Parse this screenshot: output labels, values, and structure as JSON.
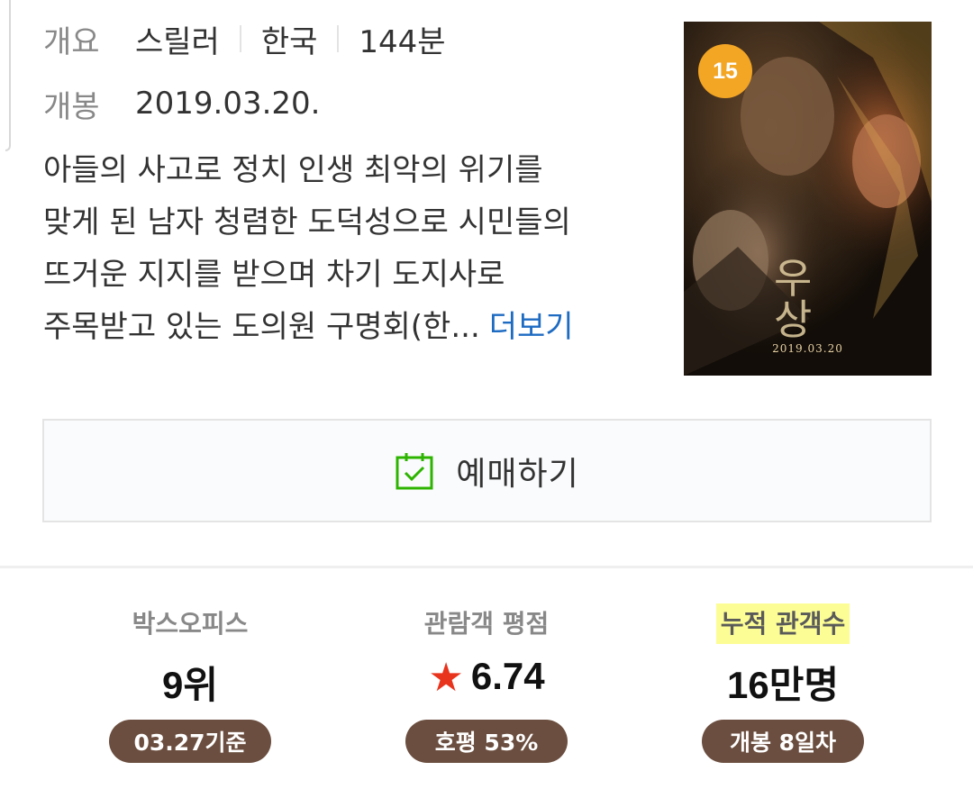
{
  "info": {
    "overview_label": "개요",
    "genre": "스릴러",
    "country": "한국",
    "runtime": "144분",
    "release_label": "개봉",
    "release_date": "2019.03.20."
  },
  "synopsis": {
    "lines": [
      "아들의 사고로 정치 인생 최악의 위기를",
      "맞게 된 남자 청렴한 도덕성으로 시민들의",
      "뜨거운 지지를 받으며 차기 도지사로",
      "주목받고 있는 도의원 구명회(한..."
    ],
    "more_label": "더보기",
    "more_color": "#1e6bc2"
  },
  "poster": {
    "age_rating": "15",
    "date_text": "2019.03.20",
    "title_text": "우상",
    "badge_color": "#f3a524"
  },
  "reserve": {
    "icon": "calendar-check-icon",
    "label": "예매하기",
    "icon_color": "#2db400"
  },
  "stats": [
    {
      "label": "박스오피스",
      "value": "9위",
      "pill": "03.27기준"
    },
    {
      "label": "관람객 평점",
      "value": "6.74",
      "icon": "star-icon",
      "pill": "호평 53%"
    },
    {
      "label": "누적 관객수",
      "value": "16만명",
      "pill": "개봉 8일차",
      "highlight_color": "#fdfd96"
    }
  ],
  "colors": {
    "pill_bg": "#6b4e3f",
    "star": "#e8331d"
  }
}
